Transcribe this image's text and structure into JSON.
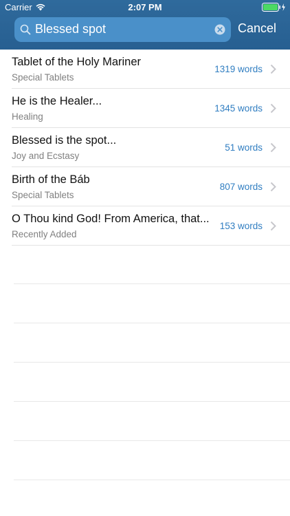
{
  "status_bar": {
    "carrier": "Carrier",
    "time": "2:07 PM"
  },
  "search": {
    "query": "Blessed spot",
    "cancel_label": "Cancel"
  },
  "results": [
    {
      "title": "Tablet of the Holy Mariner",
      "subtitle": "Special Tablets",
      "count": "1319 words"
    },
    {
      "title": "He is the Healer...",
      "subtitle": "Healing",
      "count": "1345 words"
    },
    {
      "title": "Blessed is the spot...",
      "subtitle": "Joy and Ecstasy",
      "count": "51 words"
    },
    {
      "title": "Birth of the Báb",
      "subtitle": "Special Tablets",
      "count": "807 words"
    },
    {
      "title": "O Thou kind God! From America, that...",
      "subtitle": "Recently Added",
      "count": "153 words"
    }
  ],
  "colors": {
    "header": "#2f6a9c",
    "search_field": "#4a90c9",
    "accent": "#2f7dc1"
  }
}
